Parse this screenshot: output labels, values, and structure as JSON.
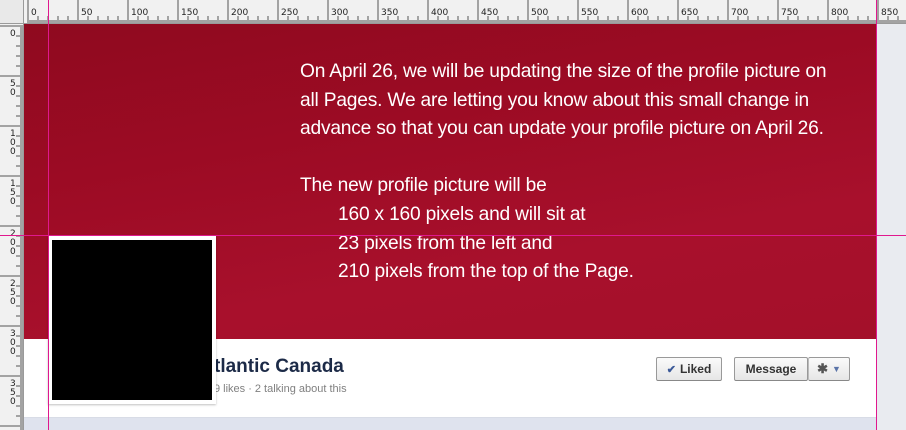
{
  "ruler": {
    "top_labels": [
      "0",
      "50",
      "100",
      "150",
      "200",
      "250",
      "300",
      "350",
      "400",
      "450",
      "500",
      "550",
      "600",
      "650",
      "700",
      "750",
      "800",
      "850"
    ],
    "left_labels": [
      "0",
      "50",
      "100",
      "150",
      "200",
      "250",
      "300",
      "350"
    ]
  },
  "cover": {
    "paragraph1": [
      "On April 26, we will be updating the size of the profile picture on",
      "all Pages. We are letting you know about this small change in",
      "advance so that you can update your profile picture on April 26."
    ],
    "intro": "The new profile picture will be",
    "details": [
      "160 x 160 pixels and will sit at",
      "23 pixels from the left and",
      "210 pixels from the top of the Page."
    ],
    "background_color": "#9c0b24"
  },
  "page": {
    "name": "tlantic Canada",
    "likes": "9 likes",
    "separator": "·",
    "talking": "2 talking about this"
  },
  "buttons": {
    "liked_label": "Liked",
    "message_label": "Message"
  },
  "icons": {
    "check": "check-icon",
    "gear": "gear-icon",
    "caret": "caret-down-icon"
  },
  "colors": {
    "guide": "#e0188e",
    "page_name": "#1c2a47",
    "accent": "#3b5998"
  }
}
